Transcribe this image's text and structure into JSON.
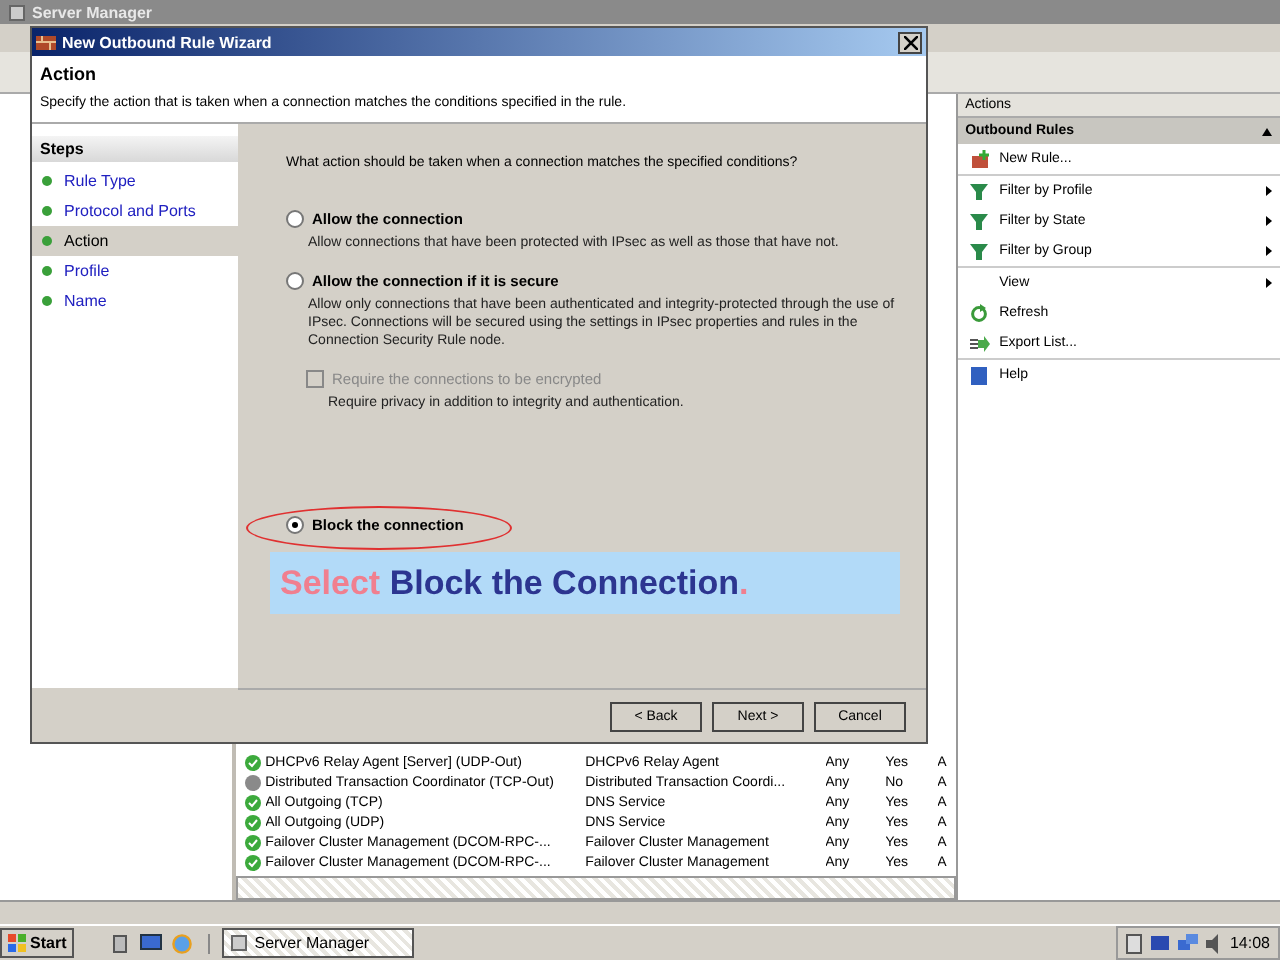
{
  "window": {
    "title": "Server Manager"
  },
  "table": {
    "rows": [
      {
        "enabled": true,
        "cells": [
          "DHCPv6 Relay Agent [Server] (UDP-Out)",
          "DHCPv6 Relay Agent",
          "Any",
          "Yes",
          "A"
        ]
      },
      {
        "enabled": false,
        "cells": [
          "Distributed Transaction Coordinator (TCP-Out)",
          "Distributed Transaction Coordi...",
          "Any",
          "No",
          "A"
        ]
      },
      {
        "enabled": true,
        "cells": [
          "All Outgoing (TCP)",
          "DNS Service",
          "Any",
          "Yes",
          "A"
        ]
      },
      {
        "enabled": true,
        "cells": [
          "All Outgoing (UDP)",
          "DNS Service",
          "Any",
          "Yes",
          "A"
        ]
      },
      {
        "enabled": true,
        "cells": [
          "Failover Cluster Management (DCOM-RPC-...",
          "Failover Cluster Management",
          "Any",
          "Yes",
          "A"
        ]
      },
      {
        "enabled": true,
        "cells": [
          "Failover Cluster Management (DCOM-RPC-...",
          "Failover Cluster Management",
          "Any",
          "Yes",
          "A"
        ]
      }
    ]
  },
  "actions": {
    "title": "Actions",
    "section": "Outbound Rules",
    "items": [
      {
        "kind": "new",
        "label": "New Rule...",
        "submenu": false,
        "divider_above": false
      },
      {
        "kind": "filter",
        "label": "Filter by Profile",
        "submenu": true,
        "divider_above": true
      },
      {
        "kind": "filter",
        "label": "Filter by State",
        "submenu": true,
        "divider_above": false
      },
      {
        "kind": "filter",
        "label": "Filter by Group",
        "submenu": true,
        "divider_above": false
      },
      {
        "kind": "plain",
        "label": "View",
        "submenu": true,
        "divider_above": true
      },
      {
        "kind": "refresh",
        "label": "Refresh",
        "submenu": false,
        "divider_above": false
      },
      {
        "kind": "export",
        "label": "Export List...",
        "submenu": false,
        "divider_above": false
      },
      {
        "kind": "help",
        "label": "Help",
        "submenu": false,
        "divider_above": true
      }
    ]
  },
  "wizard": {
    "title": "New Outbound Rule Wizard",
    "heading": "Action",
    "description": "Specify the action that is taken when a connection matches the conditions specified in the rule.",
    "steps_title": "Steps",
    "steps": [
      {
        "label": "Rule Type",
        "selected": false
      },
      {
        "label": "Protocol and Ports",
        "selected": false
      },
      {
        "label": "Action",
        "selected": true
      },
      {
        "label": "Profile",
        "selected": false
      },
      {
        "label": "Name",
        "selected": false
      }
    ],
    "question": "What action should be taken when a connection matches the specified conditions?",
    "options": [
      {
        "kind": "radio",
        "label": "Allow the connection",
        "description": "Allow connections that have been protected with IPsec as well as those that have not.",
        "selected": false
      },
      {
        "kind": "radio",
        "label": "Allow the connection if it is secure",
        "description": "Allow only connections that have been authenticated and integrity-protected through the use of IPsec. Connections will be secured using the settings in IPsec properties and rules in the Connection Security Rule node.",
        "selected": false
      },
      {
        "kind": "checkbox",
        "label": "Require the connections to be encrypted",
        "description": "Require privacy in addition to integrity and authentication.",
        "checked": false,
        "disabled": true
      },
      {
        "kind": "radio",
        "label": "Block the connection",
        "selected": true
      }
    ],
    "buttons": [
      "< Back",
      "Next >",
      "Cancel"
    ]
  },
  "annotation": {
    "segments": [
      {
        "text": "Select ",
        "color": "#f07f8f"
      },
      {
        "text": "Block the Connection",
        "color": "#2c3590"
      },
      {
        "text": ".",
        "color": "#f07f8f"
      }
    ]
  },
  "taskbar": {
    "start": "Start",
    "tasks": [
      "Server Manager"
    ],
    "clock": "14:08"
  }
}
